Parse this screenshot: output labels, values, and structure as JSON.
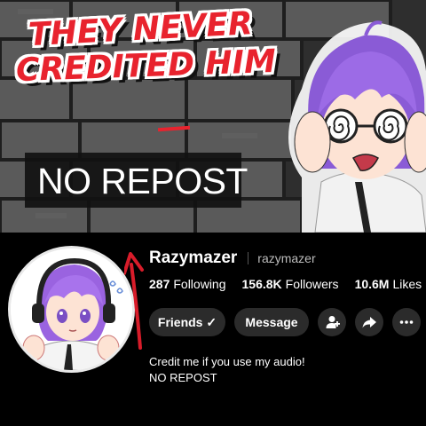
{
  "banner": {
    "headline_line1": "THEY NEVER",
    "headline_line2": "CREDITED HIM",
    "caption": "NO REPOST"
  },
  "profile": {
    "display_name": "Razymazer",
    "username": "razymazer",
    "stats": [
      {
        "value": "287",
        "label": "Following"
      },
      {
        "value": "156.8K",
        "label": "Followers"
      },
      {
        "value": "10.6M",
        "label": "Likes"
      }
    ],
    "buttons": {
      "friends": "Friends ✓",
      "message": "Message"
    },
    "bio_line1": "Credit me if you use my audio!",
    "bio_line2": "NO REPOST"
  },
  "icons": {
    "add_friend": "person-plus-icon",
    "share": "share-arrow-icon",
    "more": "more-dots-icon"
  },
  "colors": {
    "accent_red": "#e8232e",
    "button_bg": "#2b2b2b",
    "page_bg": "#000000"
  }
}
